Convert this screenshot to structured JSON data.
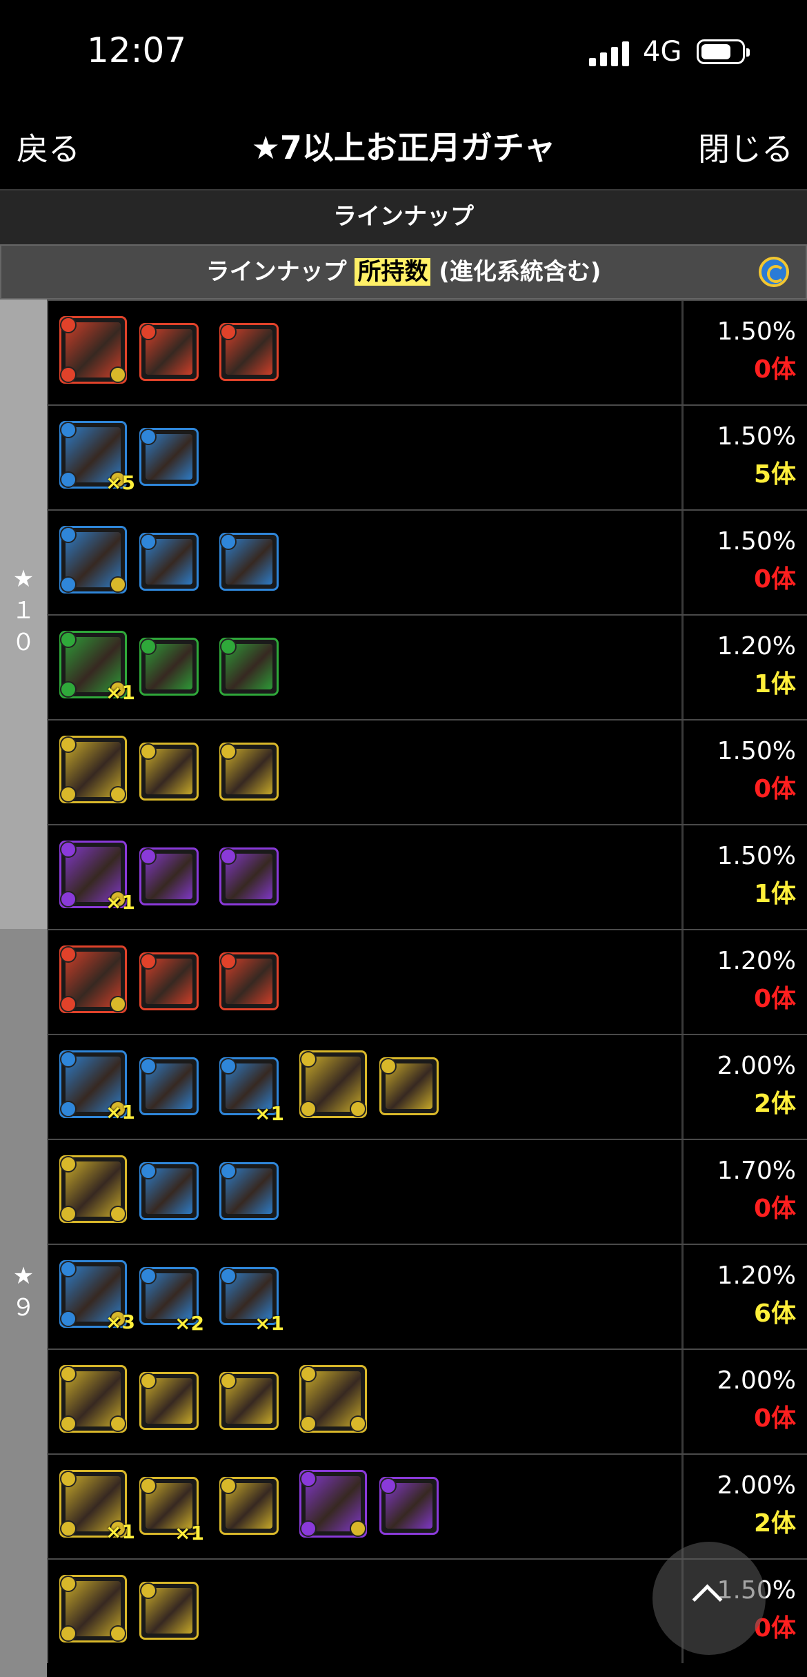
{
  "status": {
    "time": "12:07",
    "network": "4G"
  },
  "nav": {
    "back": "戻る",
    "title": "★7以上お正月ガチャ",
    "close": "閉じる"
  },
  "section": {
    "title": "ラインナップ"
  },
  "subheader": {
    "prefix": "ラインナップ",
    "highlight": "所持数",
    "suffix": "(進化系統含む)"
  },
  "groups": [
    {
      "label": "★\n１\n０",
      "color": "#a8a8a8"
    },
    {
      "label": "★\n９",
      "color": "#8a8a8a"
    }
  ],
  "colors": {
    "fire": "#e0422a",
    "water": "#2f86d9",
    "wood": "#2fa83a",
    "light": "#d9b82a",
    "dark": "#8a3ad9",
    "owned_zero": "#ff1f1f",
    "owned_pos": "#ffef3a"
  },
  "rows": [
    {
      "rate": "1.50%",
      "owned": "0体",
      "icons": [
        {
          "attr": "fire",
          "big": true
        },
        {
          "attr": "fire"
        },
        {
          "attr": "fire"
        }
      ]
    },
    {
      "rate": "1.50%",
      "owned": "5体",
      "icons": [
        {
          "attr": "water",
          "big": true,
          "count": "×5"
        },
        {
          "attr": "water"
        }
      ]
    },
    {
      "rate": "1.50%",
      "owned": "0体",
      "icons": [
        {
          "attr": "water",
          "big": true
        },
        {
          "attr": "water"
        },
        {
          "attr": "water"
        }
      ]
    },
    {
      "rate": "1.20%",
      "owned": "1体",
      "icons": [
        {
          "attr": "wood",
          "big": true,
          "count": "×1"
        },
        {
          "attr": "wood"
        },
        {
          "attr": "wood"
        }
      ]
    },
    {
      "rate": "1.50%",
      "owned": "0体",
      "icons": [
        {
          "attr": "light",
          "big": true
        },
        {
          "attr": "light"
        },
        {
          "attr": "light"
        }
      ]
    },
    {
      "rate": "1.50%",
      "owned": "1体",
      "icons": [
        {
          "attr": "dark",
          "big": true,
          "count": "×1"
        },
        {
          "attr": "dark"
        },
        {
          "attr": "dark"
        }
      ]
    },
    {
      "rate": "1.20%",
      "owned": "0体",
      "icons": [
        {
          "attr": "fire",
          "big": true
        },
        {
          "attr": "fire"
        },
        {
          "attr": "fire"
        }
      ]
    },
    {
      "rate": "2.00%",
      "owned": "2体",
      "icons": [
        {
          "attr": "water",
          "big": true,
          "count": "×1"
        },
        {
          "attr": "water"
        },
        {
          "attr": "water",
          "count": "×1"
        },
        {
          "attr": "light",
          "big": true
        },
        {
          "attr": "light"
        }
      ]
    },
    {
      "rate": "1.70%",
      "owned": "0体",
      "icons": [
        {
          "attr": "light",
          "big": true
        },
        {
          "attr": "water"
        },
        {
          "attr": "water"
        }
      ]
    },
    {
      "rate": "1.20%",
      "owned": "6体",
      "icons": [
        {
          "attr": "water",
          "big": true,
          "count": "×3"
        },
        {
          "attr": "water",
          "count": "×2"
        },
        {
          "attr": "water",
          "count": "×1"
        }
      ]
    },
    {
      "rate": "2.00%",
      "owned": "0体",
      "icons": [
        {
          "attr": "light",
          "big": true
        },
        {
          "attr": "light"
        },
        {
          "attr": "light"
        },
        {
          "attr": "light",
          "big": true
        }
      ]
    },
    {
      "rate": "2.00%",
      "owned": "2体",
      "icons": [
        {
          "attr": "light",
          "big": true,
          "count": "×1"
        },
        {
          "attr": "light",
          "count": "×1"
        },
        {
          "attr": "light"
        },
        {
          "attr": "dark",
          "big": true
        },
        {
          "attr": "dark"
        }
      ]
    },
    {
      "rate": "1.50%",
      "owned": "0体",
      "icons": [
        {
          "attr": "light",
          "big": true
        },
        {
          "attr": "light"
        }
      ]
    }
  ]
}
